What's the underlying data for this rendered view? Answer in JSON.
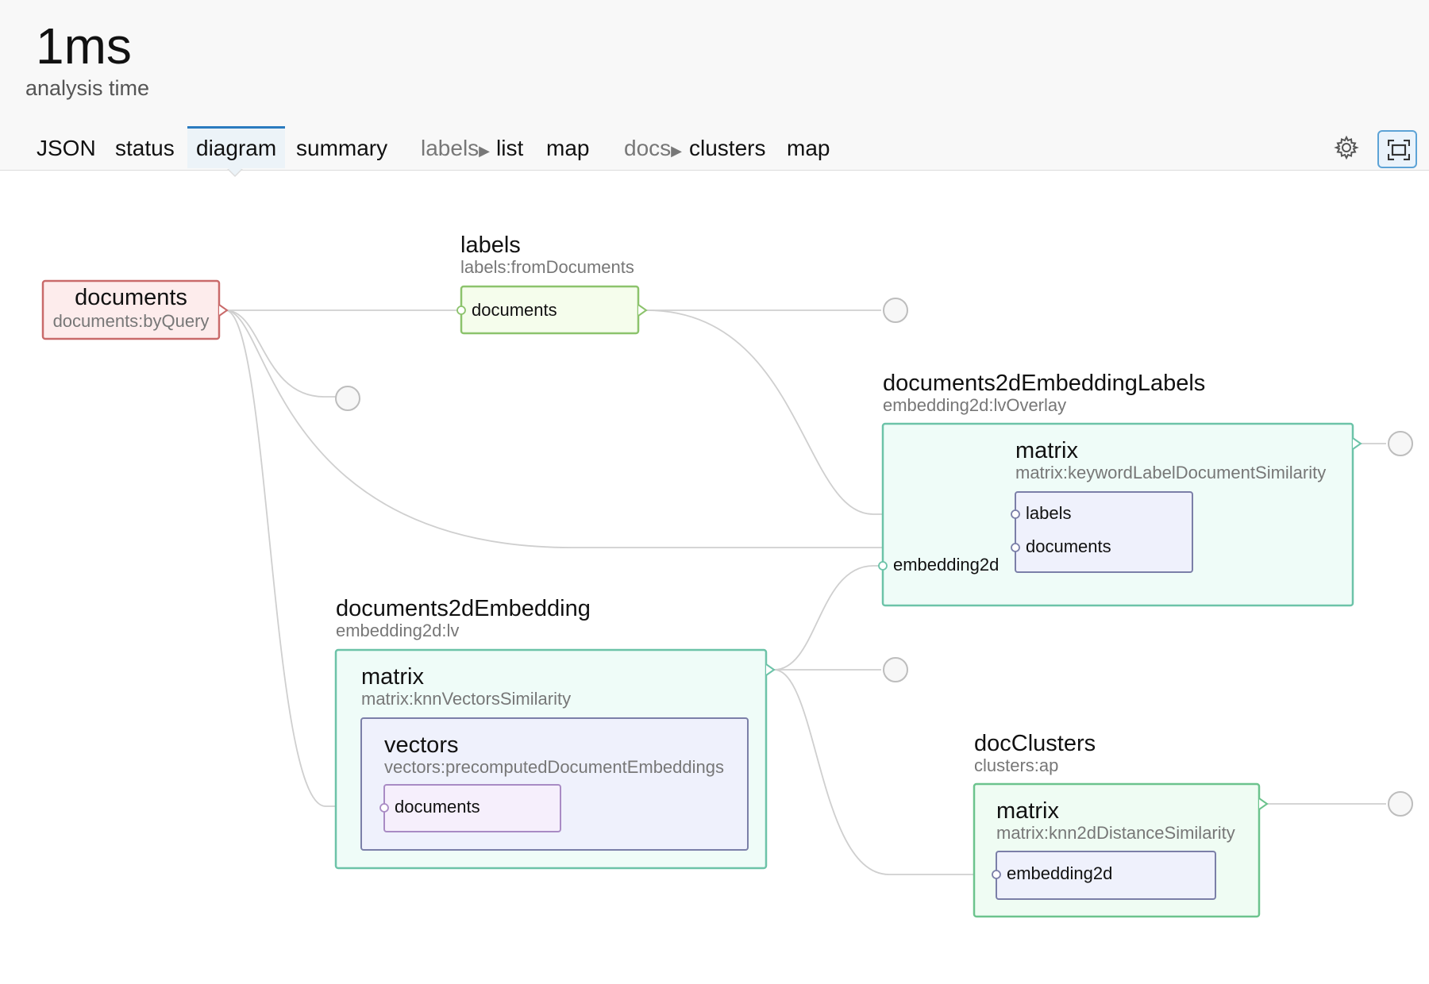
{
  "header": {
    "time_value": "1ms",
    "time_label": "analysis time"
  },
  "tabs": [
    {
      "label": "JSON"
    },
    {
      "label": "status"
    },
    {
      "label": "diagram",
      "active": true
    },
    {
      "label": "summary"
    }
  ],
  "tab_groups": {
    "labels": {
      "prefix": "labels",
      "items": [
        "list",
        "map"
      ]
    },
    "docs": {
      "prefix": "docs",
      "items": [
        "clusters",
        "map"
      ]
    }
  },
  "toolbar": {
    "settings_icon": "gear-icon",
    "fullscreen_icon": "fullscreen-icon"
  },
  "colors": {
    "accent": "#2b7bbf",
    "source_node_border": "#c96a6a",
    "source_node_fill": "#fdecec",
    "labels_node_border": "#8cc36c",
    "labels_node_fill": "#f5fdec",
    "embedding_border": "#6cc3a8",
    "embedding_fill": "#effcf8",
    "inner_border": "#7b7fa8",
    "inner_fill": "#eff1fc",
    "purple_border": "#a98bc4",
    "purple_fill": "#f6effc"
  },
  "diagram": {
    "documents": {
      "title": "documents",
      "subtitle": "documents:byQuery"
    },
    "labels": {
      "title": "labels",
      "subtitle": "labels:fromDocuments",
      "input": "documents"
    },
    "documents2dEmbeddingLabels": {
      "title": "documents2dEmbeddingLabels",
      "subtitle": "embedding2d:lvOverlay",
      "input": "embedding2d",
      "matrix": {
        "title": "matrix",
        "subtitle": "matrix:keywordLabelDocumentSimilarity",
        "inputs": [
          "labels",
          "documents"
        ]
      }
    },
    "documents2dEmbedding": {
      "title": "documents2dEmbedding",
      "subtitle": "embedding2d:lv",
      "matrix": {
        "title": "matrix",
        "subtitle": "matrix:knnVectorsSimilarity",
        "vectors": {
          "title": "vectors",
          "subtitle": "vectors:precomputedDocumentEmbeddings",
          "input": "documents"
        }
      }
    },
    "docClusters": {
      "title": "docClusters",
      "subtitle": "clusters:ap",
      "matrix": {
        "title": "matrix",
        "subtitle": "matrix:knn2dDistanceSimilarity",
        "input": "embedding2d"
      }
    }
  }
}
